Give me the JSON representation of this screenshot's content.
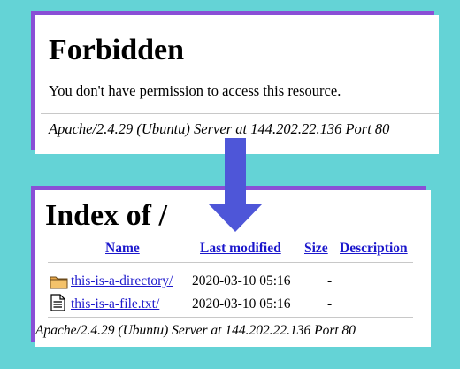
{
  "forbidden_page": {
    "title": "Forbidden",
    "message": "You don't have permission to access this resource.",
    "server_signature": "Apache/2.4.29 (Ubuntu) Server at 144.202.22.136 Port 80"
  },
  "index_page": {
    "title": "Index of /",
    "columns": {
      "name": "Name",
      "last_modified": "Last modified",
      "size": "Size",
      "description": "Description"
    },
    "rows": [
      {
        "icon": "folder-icon",
        "name": "this-is-a-directory/",
        "modified": "2020-03-10 05:16",
        "size": "-"
      },
      {
        "icon": "text-file-icon",
        "name": "this-is-a-file.txt/",
        "modified": "2020-03-10 05:16",
        "size": "-"
      }
    ],
    "server_signature": "Apache/2.4.29 (Ubuntu) Server at 144.202.22.136 Port 80"
  },
  "colors": {
    "background": "#64d3d6",
    "accent_purple": "#8a4fd6",
    "arrow": "#4e56d8",
    "link": "#1b17cc"
  },
  "decorations": {
    "arrow_icon": "down-arrow-icon"
  }
}
